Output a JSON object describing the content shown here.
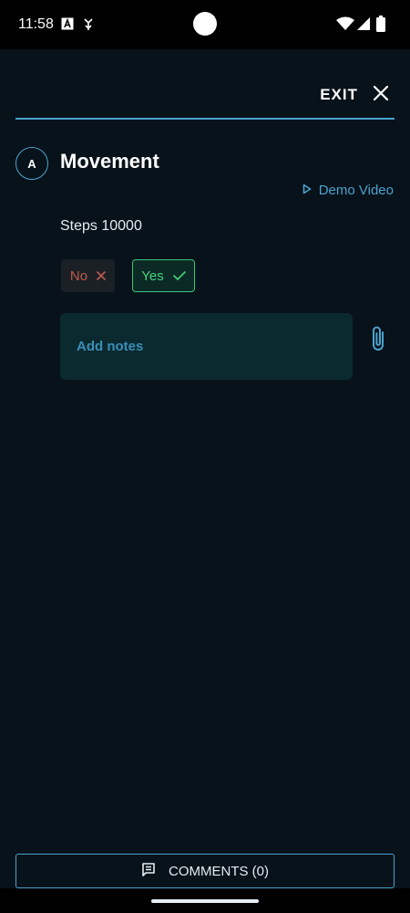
{
  "status_bar": {
    "time": "11:58",
    "icons": [
      "text-a-icon",
      "usb-icon",
      "wifi-icon",
      "signal-icon",
      "battery-icon"
    ]
  },
  "header": {
    "exit_label": "EXIT",
    "close_icon": "close-icon"
  },
  "section": {
    "badge": "A",
    "title": "Movement",
    "demo_video_label": "Demo Video",
    "question": "Steps 10000"
  },
  "choices": {
    "no_label": "No",
    "yes_label": "Yes",
    "selected": "Yes"
  },
  "notes": {
    "placeholder": "Add notes"
  },
  "footer": {
    "comments_label": "COMMENTS (0)"
  },
  "colors": {
    "background": "#08121a",
    "accent": "#4aa3cf",
    "yes_green": "#44d17f",
    "no_red": "#c25c4d"
  }
}
